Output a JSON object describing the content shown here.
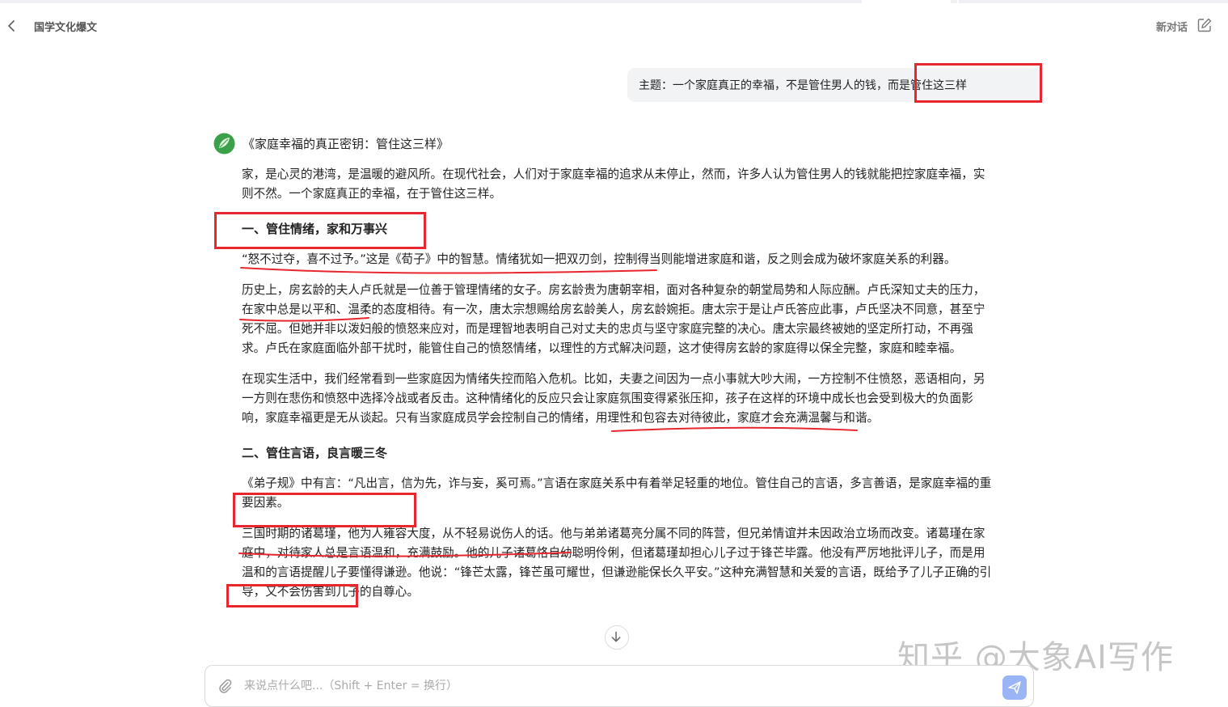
{
  "header": {
    "title": "国学文化爆文",
    "new_chat_label": "新对话"
  },
  "user_message": {
    "text_a": "主题：一个家庭真正的幸福，不是管住男人的钱，",
    "text_b": "而是管住这三样"
  },
  "reply": {
    "title": "《家庭幸福的真正密钥：管住这三样》",
    "intro": "家，是心灵的港湾，是温暖的避风所。在现代社会，人们对于家庭幸福的追求从未停止，然而，许多人认为管住男人的钱就能把控家庭幸福，实则不然。一个家庭真正的幸福，在于管住这三样。",
    "section1_heading": "一、管住情绪，家和万事兴",
    "s1_p1": "“怒不过夺，喜不过予。”这是《荀子》中的智慧。情绪犹如一把双刃剑，控制得当则能增进家庭和谐，反之则会成为破坏家庭关系的利器。",
    "s1_p2": "历史上，房玄龄的夫人卢氏就是一位善于管理情绪的女子。房玄龄贵为唐朝宰相，面对各种复杂的朝堂局势和人际应酬。卢氏深知丈夫的压力，在家中总是以平和、温柔的态度相待。有一次，唐太宗想赐给房玄龄美人，房玄龄婉拒。唐太宗于是让卢氏答应此事，卢氏坚决不同意，甚至宁死不屈。但她并非以泼妇般的愤怒来应对，而是理智地表明自己对丈夫的忠贞与坚守家庭完整的决心。唐太宗最终被她的坚定所打动，不再强求。卢氏在家庭面临外部干扰时，能管住自己的愤怒情绪，以理性的方式解决问题，这才使得房玄龄的家庭得以保全完整，家庭和睦幸福。",
    "s1_p3": "在现实生活中，我们经常看到一些家庭因为情绪失控而陷入危机。比如，夫妻之间因为一点小事就大吵大闹，一方控制不住愤怒，恶语相向，另一方则在悲伤和愤怒中选择冷战或者反击。这种情绪化的反应只会让家庭氛围变得紧张压抑，孩子在这样的环境中成长也会受到极大的负面影响，家庭幸福更是无从谈起。只有当家庭成员学会控制自己的情绪，用理性和包容去对待彼此，家庭才会充满温馨与和谐。",
    "section2_heading": "二、管住言语，良言暖三冬",
    "s2_p1": "《弟子规》中有言：“凡出言，信为先，诈与妄，奚可焉。”言语在家庭关系中有着举足轻重的地位。管住自己的言语，多言善语，是家庭幸福的重要因素。",
    "s2_p2": "三国时期的诸葛瑾，他为人雍容大度，从不轻易说伤人的话。他与弟弟诸葛亮分属不同的阵营，但兄弟情谊并未因政治立场而改变。诸葛瑾在家庭中，对待家人总是言语温和，充满鼓励。他的儿子诸葛恪自幼聪明伶俐，但诸葛瑾却担心儿子过于锋芒毕露。他没有严厉地批评儿子，而是用温和的言语提醒儿子要懂得谦逊。他说：“锋芒太露，锋芒虽可耀世，但谦逊能保长久平安。”这种充满智慧和关爱的言语，既给予了儿子正确的引导，又不会伤害到儿子的自尊心。"
  },
  "input": {
    "placeholder": "来说点什么吧...（Shift + Enter = 换行）"
  },
  "watermark": "知乎 @大象AI写作",
  "icons": [
    "chevron-left-icon",
    "edit-icon",
    "app-logo-icon",
    "arrow-down-icon",
    "paperclip-icon",
    "send-icon"
  ],
  "colors": {
    "annotation_red": "#e8262d",
    "send_button": "#9ab5f5"
  }
}
